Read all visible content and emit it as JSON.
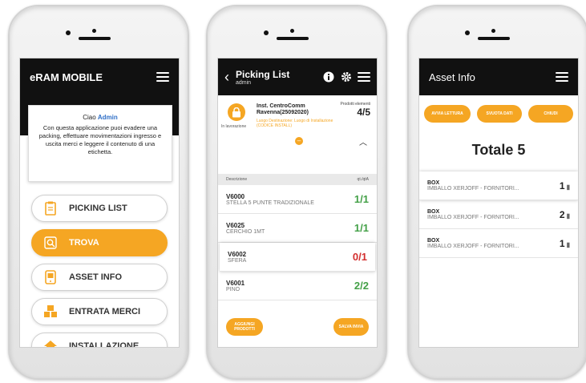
{
  "phone1": {
    "app_title": "eRAM MOBILE",
    "greeting_prefix": "Ciao ",
    "greeting_user": "Admin",
    "description": "Con questa applicazione puoi evadere una packing, effettuare movimentazioni ingresso e uscita merci e leggere il contenuto di una etichetta.",
    "menu": [
      {
        "label": "PICKING LIST",
        "icon": "clipboard-icon"
      },
      {
        "label": "TROVA",
        "icon": "search-icon"
      },
      {
        "label": "ASSET INFO",
        "icon": "tablet-icon"
      },
      {
        "label": "ENTRATA MERCI",
        "icon": "boxes-icon"
      },
      {
        "label": "INSTALLAZIONE",
        "icon": "house-icon"
      }
    ]
  },
  "phone2": {
    "title": "Picking List",
    "subtitle": "admin",
    "lock_label": "In lavorazione",
    "inst_name": "Inst. CentroComm Ravenna(25092020)",
    "inst_sub": "Luogo Destinazione: Luogo di Installazione (CODICE INSTALL)",
    "products_label": "Prodotti elementi",
    "products_value": "4/5",
    "col_desc": "Descrizione",
    "col_qty": "qt./qtA",
    "rows": [
      {
        "code": "V6000",
        "desc": "STELLA 5 PUNTE TRADIZIONALE",
        "qty": "1/1",
        "status": "ok"
      },
      {
        "code": "V6025",
        "desc": "CERCHIO 1MT",
        "qty": "1/1",
        "status": "ok"
      },
      {
        "code": "V6002",
        "desc": "SFERA",
        "qty": "0/1",
        "status": "missing"
      },
      {
        "code": "V6001",
        "desc": "PINO",
        "qty": "2/2",
        "status": "ok"
      }
    ],
    "btn_add": "AGGIUNGI PRODOTTI",
    "btn_save": "SALVA INVIA"
  },
  "phone3": {
    "title": "Asset Info",
    "buttons": [
      "AVVIA LETTURA",
      "SVUOTA DATI",
      "CHIUDI"
    ],
    "total": "Totale 5",
    "rows": [
      {
        "code": "BOX",
        "desc": "IMBALLO XERJOFF - FORNITORI...",
        "qty": "1"
      },
      {
        "code": "BOX",
        "desc": "IMBALLO XERJOFF - FORNITORI...",
        "qty": "2"
      },
      {
        "code": "BOX",
        "desc": "IMBALLO XERJOFF - FORNITORI...",
        "qty": "1"
      }
    ]
  },
  "colors": {
    "accent": "#f5a623",
    "bar": "#111111",
    "ok": "#43a047",
    "missing": "#d32f2f"
  }
}
